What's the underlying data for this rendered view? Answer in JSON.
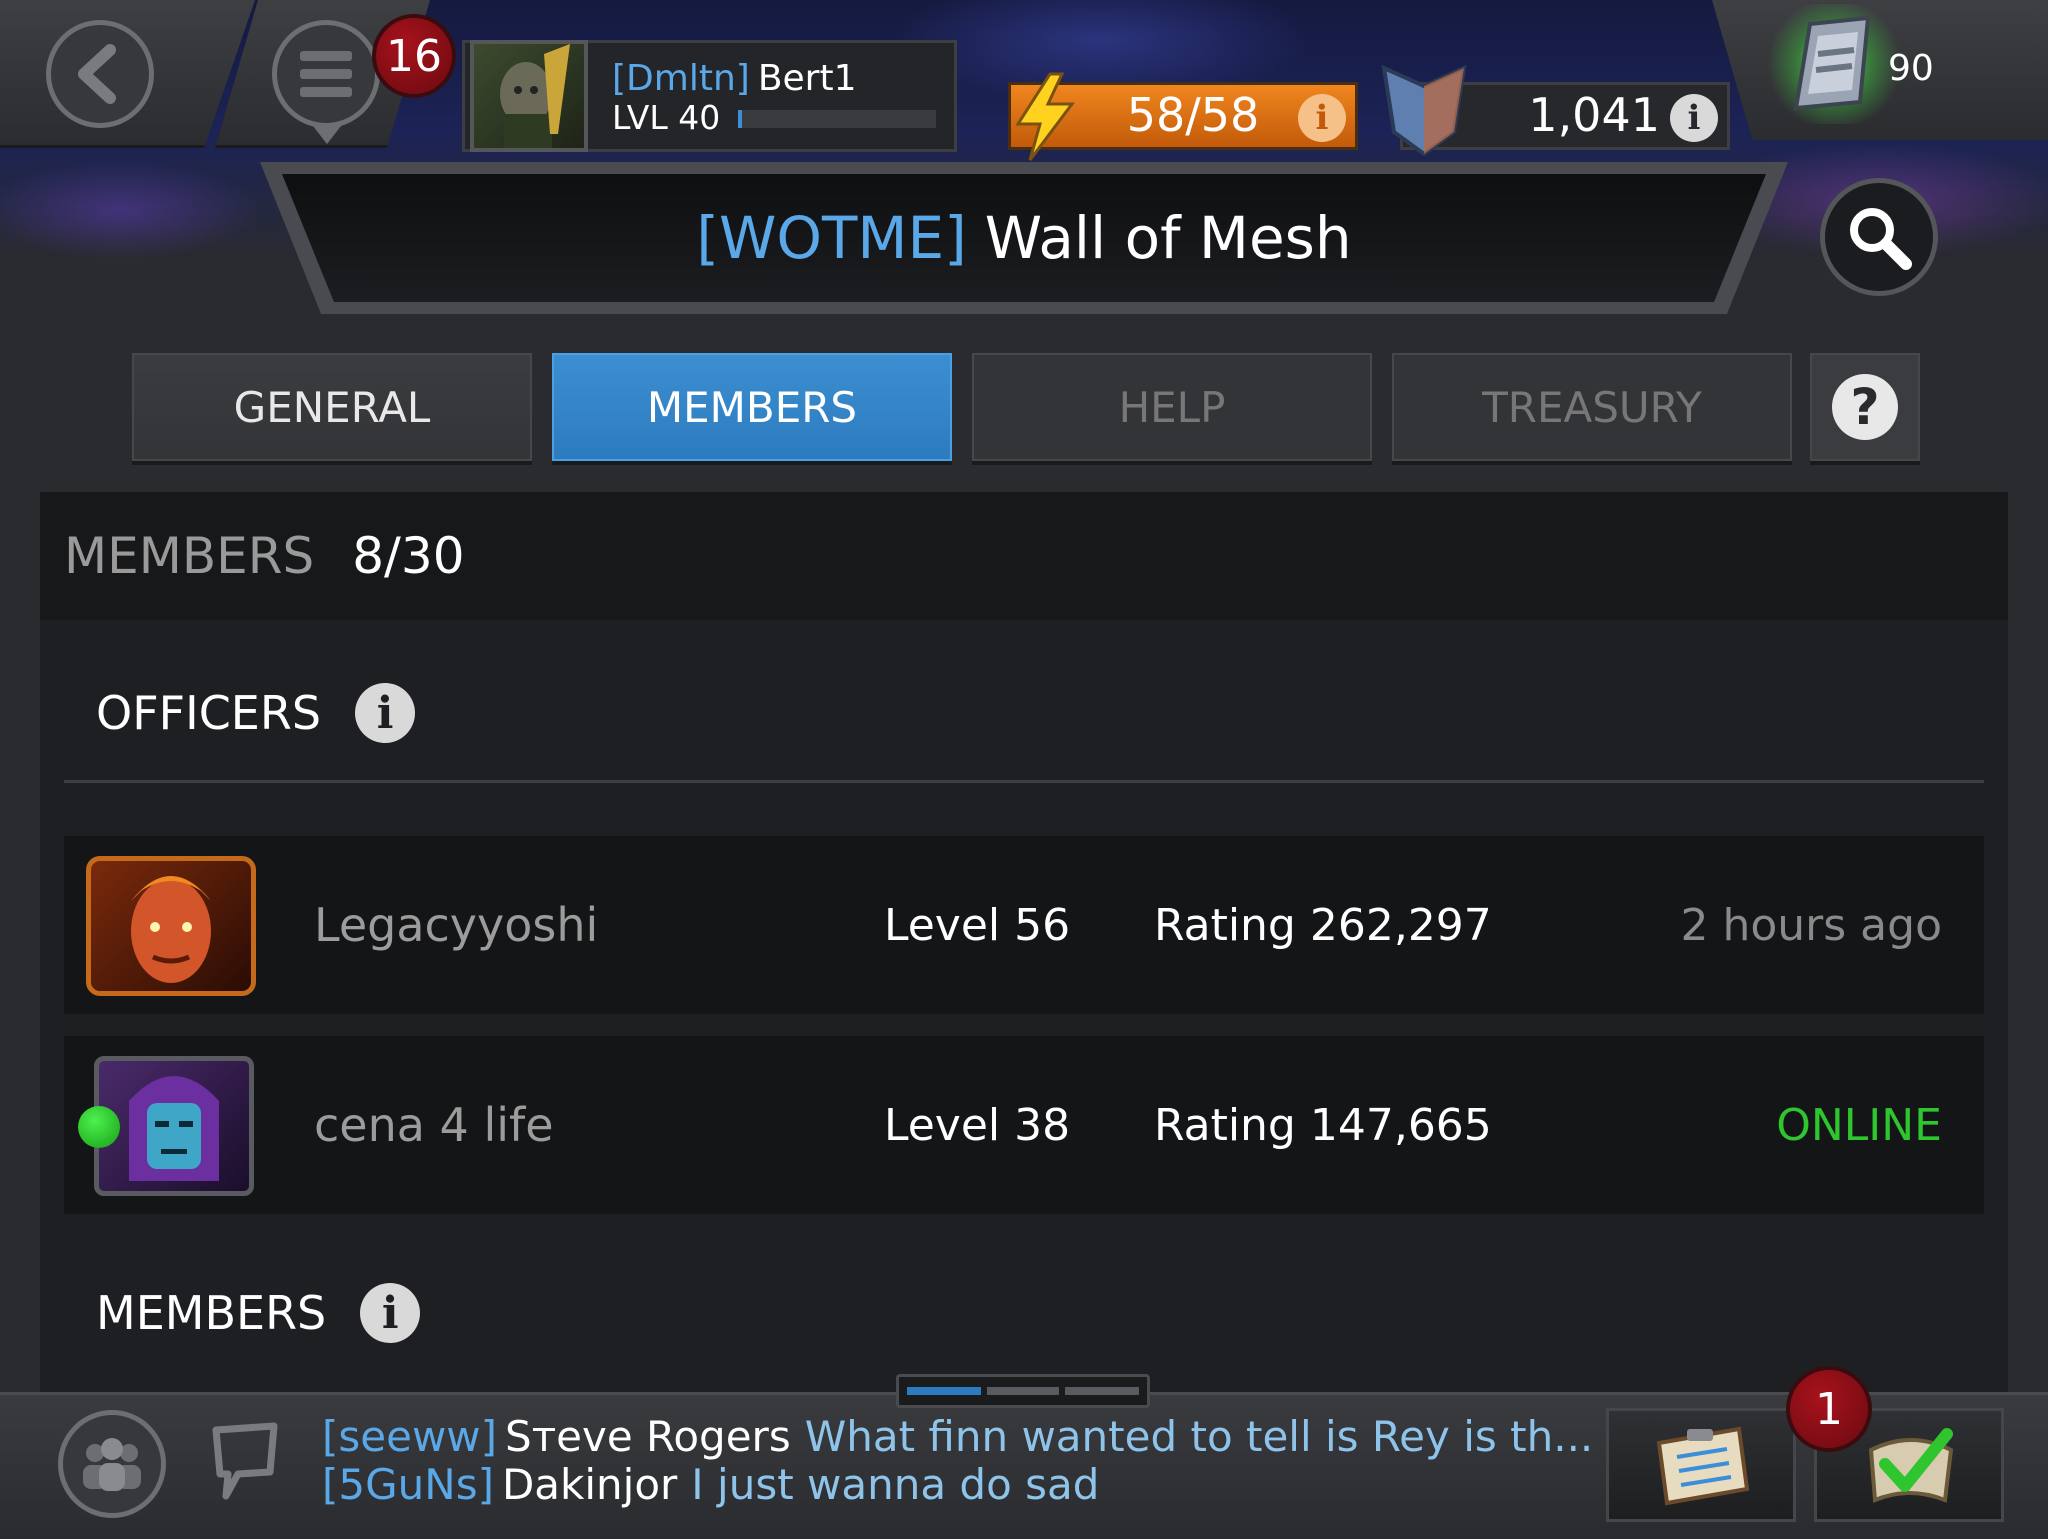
{
  "header": {
    "notification_count": "16",
    "player": {
      "alliance_tag": "[Dmltn]",
      "name": "Bert1",
      "level": "LVL 40",
      "xp_fraction": 0.02
    },
    "energy": {
      "value": "58/58"
    },
    "units": {
      "value": "1,041"
    },
    "crystals": {
      "value": "90"
    }
  },
  "alliance": {
    "tag": "[WOTME]",
    "name": "Wall of Mesh"
  },
  "tabs": [
    {
      "label": "GENERAL",
      "state": "normal"
    },
    {
      "label": "MEMBERS",
      "state": "active"
    },
    {
      "label": "HELP",
      "state": "disabled"
    },
    {
      "label": "TREASURY",
      "state": "disabled"
    }
  ],
  "help_symbol": "?",
  "members_summary": {
    "label": "MEMBERS",
    "count": "8/30"
  },
  "officers_section": {
    "title": "OFFICERS",
    "info_symbol": "i"
  },
  "officers": [
    {
      "name": "Legacyyoshi",
      "level": "Level 56",
      "rating": "Rating 262,297",
      "status": "2 hours ago",
      "online": false,
      "avatar_icon": "human-torch-portrait-icon"
    },
    {
      "name": "cena 4 life",
      "level": "Level 38",
      "rating": "Rating 147,665",
      "status": "ONLINE",
      "online": true,
      "avatar_icon": "kang-portrait-icon"
    }
  ],
  "members_section": {
    "title": "MEMBERS",
    "info_symbol": "i"
  },
  "chat": [
    {
      "tag": "[seeww]",
      "user": "Sтeve Rogers",
      "message": "What finn wanted to tell is Rey is th..."
    },
    {
      "tag": "[5GuNs]",
      "user": "Dakinjor",
      "message": "I just wanna do sad"
    }
  ],
  "quest_badge": "1",
  "colors": {
    "accent_blue": "#2d7bbf",
    "online_green": "#2ec52e",
    "energy_orange": "#e0761a",
    "badge_red": "#8a0f16"
  }
}
